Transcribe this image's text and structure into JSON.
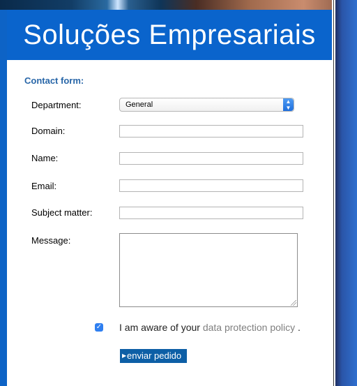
{
  "header": {
    "title": "Soluções Empresariais"
  },
  "form": {
    "section_title": "Contact form:",
    "department": {
      "label": "Department:",
      "value": "General"
    },
    "domain": {
      "label": "Domain:",
      "value": ""
    },
    "name": {
      "label": "Name:",
      "value": ""
    },
    "email": {
      "label": "Email:",
      "value": ""
    },
    "subject": {
      "label": "Subject matter:",
      "value": ""
    },
    "message": {
      "label": "Message:",
      "value": ""
    },
    "consent": {
      "checked": true,
      "text_before": "I am aware of your",
      "link_text": "data protection policy",
      "text_after": "."
    },
    "submit_label": "enviar pedido"
  },
  "colors": {
    "banner": "#0a64cc",
    "section_title": "#2866a8",
    "button": "#0d5fa6",
    "link": "#7f7f7f"
  },
  "icons": {
    "select_arrows": "updown-arrows-icon",
    "checkbox": "checkmark-icon",
    "button_arrow": "triangle-right-icon"
  }
}
